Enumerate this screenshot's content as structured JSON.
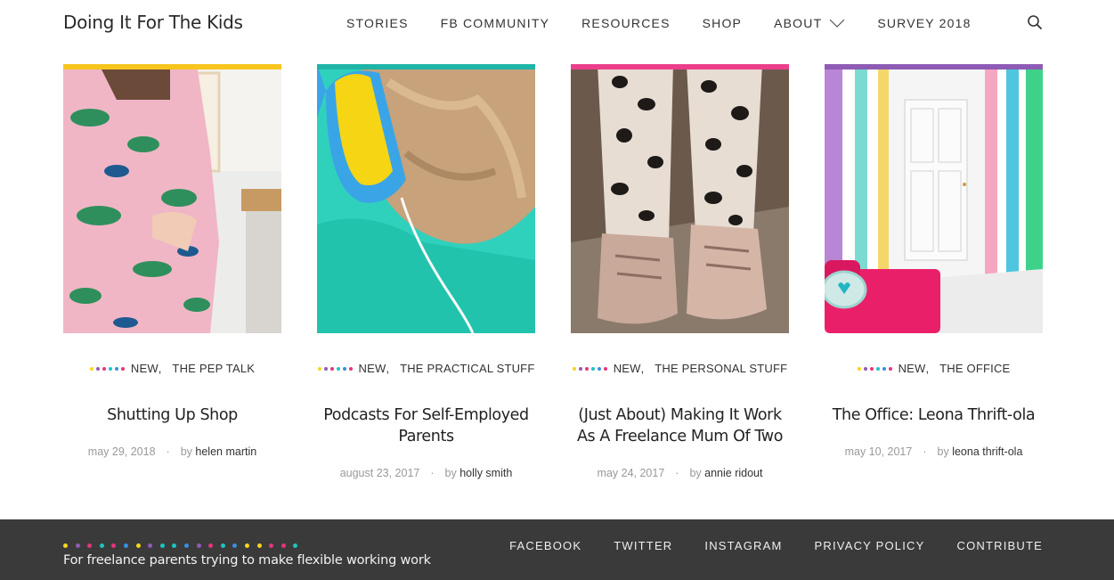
{
  "site": {
    "logo": "Doing It For The Kids"
  },
  "nav": {
    "items": [
      "STORIES",
      "FB COMMUNITY",
      "RESOURCES",
      "SHOP",
      "ABOUT",
      "SURVEY 2018"
    ]
  },
  "colors": {
    "dots": [
      "#f7d51d",
      "#8e5bb5",
      "#e8347c",
      "#1fc4bf",
      "#3b8fe0",
      "#e8347c"
    ],
    "footer_dots": [
      "#f7d51d",
      "#8e5bb5",
      "#e8347c",
      "#1fc4bf",
      "#e8347c",
      "#3b8fe0",
      "#f7d51d",
      "#8e5bb5",
      "#1fc4bf",
      "#1fc4bf",
      "#3b8fe0",
      "#8e5bb5",
      "#e8347c",
      "#1fc4bf",
      "#3b8fe0",
      "#f7d51d",
      "#f7d51d",
      "#e8347c",
      "#e8347c",
      "#1fc4bf"
    ]
  },
  "posts": [
    {
      "bar_color": "#f7c51d",
      "categories": [
        "NEW",
        "THE PEP TALK"
      ],
      "title": "Shutting Up Shop",
      "date": "may 29, 2018",
      "by": "by",
      "author": "helen martin"
    },
    {
      "bar_color": "#1fb5a6",
      "categories": [
        "NEW",
        "THE PRACTICAL STUFF"
      ],
      "title": "Podcasts For Self-Employed Parents",
      "date": "august 23, 2017",
      "by": "by",
      "author": "holly smith"
    },
    {
      "bar_color": "#ec3f8b",
      "categories": [
        "NEW",
        "THE PERSONAL STUFF"
      ],
      "title": "(Just About) Making It Work As A Freelance Mum Of Two",
      "date": "may 24, 2017",
      "by": "by",
      "author": "annie ridout"
    },
    {
      "bar_color": "#8e5bb5",
      "categories": [
        "NEW",
        "THE OFFICE"
      ],
      "title": "The Office: Leona Thrift-ola",
      "date": "may 10, 2017",
      "by": "by",
      "author": "leona thrift-ola"
    }
  ],
  "footer": {
    "tagline": "For freelance parents trying to make flexible working work",
    "links": [
      "FACEBOOK",
      "TWITTER",
      "INSTAGRAM",
      "PRIVACY POLICY",
      "CONTRIBUTE"
    ]
  }
}
